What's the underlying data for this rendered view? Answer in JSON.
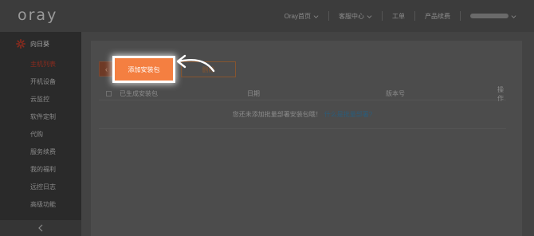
{
  "header": {
    "logo": "oray",
    "nav": [
      {
        "label": "Oray首页",
        "has_dropdown": true
      },
      {
        "label": "客服中心",
        "has_dropdown": true
      },
      {
        "label": "工单",
        "has_dropdown": false
      },
      {
        "label": "产品续费",
        "has_dropdown": false
      }
    ]
  },
  "sidebar": {
    "product": "向日葵",
    "items": [
      {
        "label": "主机列表",
        "active": true
      },
      {
        "label": "开机设备",
        "active": false
      },
      {
        "label": "云监控",
        "active": false
      },
      {
        "label": "软件定制",
        "active": false
      },
      {
        "label": "代购",
        "active": false
      },
      {
        "label": "服务续费",
        "active": false
      },
      {
        "label": "我的福利",
        "active": false
      },
      {
        "label": "远控日志",
        "active": false
      },
      {
        "label": "高级功能",
        "active": false
      }
    ]
  },
  "toolbar": {
    "back_label": "‹",
    "add_label": "添加安装包",
    "delete_label": "删除"
  },
  "table": {
    "columns": [
      "已生成安装包",
      "日期",
      "版本号",
      "操作"
    ],
    "empty_text": "您还未添加批量部署安装包哦！",
    "empty_link": "什么是批量部署?"
  },
  "colors": {
    "accent": "#f47f41",
    "active_sidebar": "#8e2b1d",
    "link": "#2b5c7a"
  }
}
